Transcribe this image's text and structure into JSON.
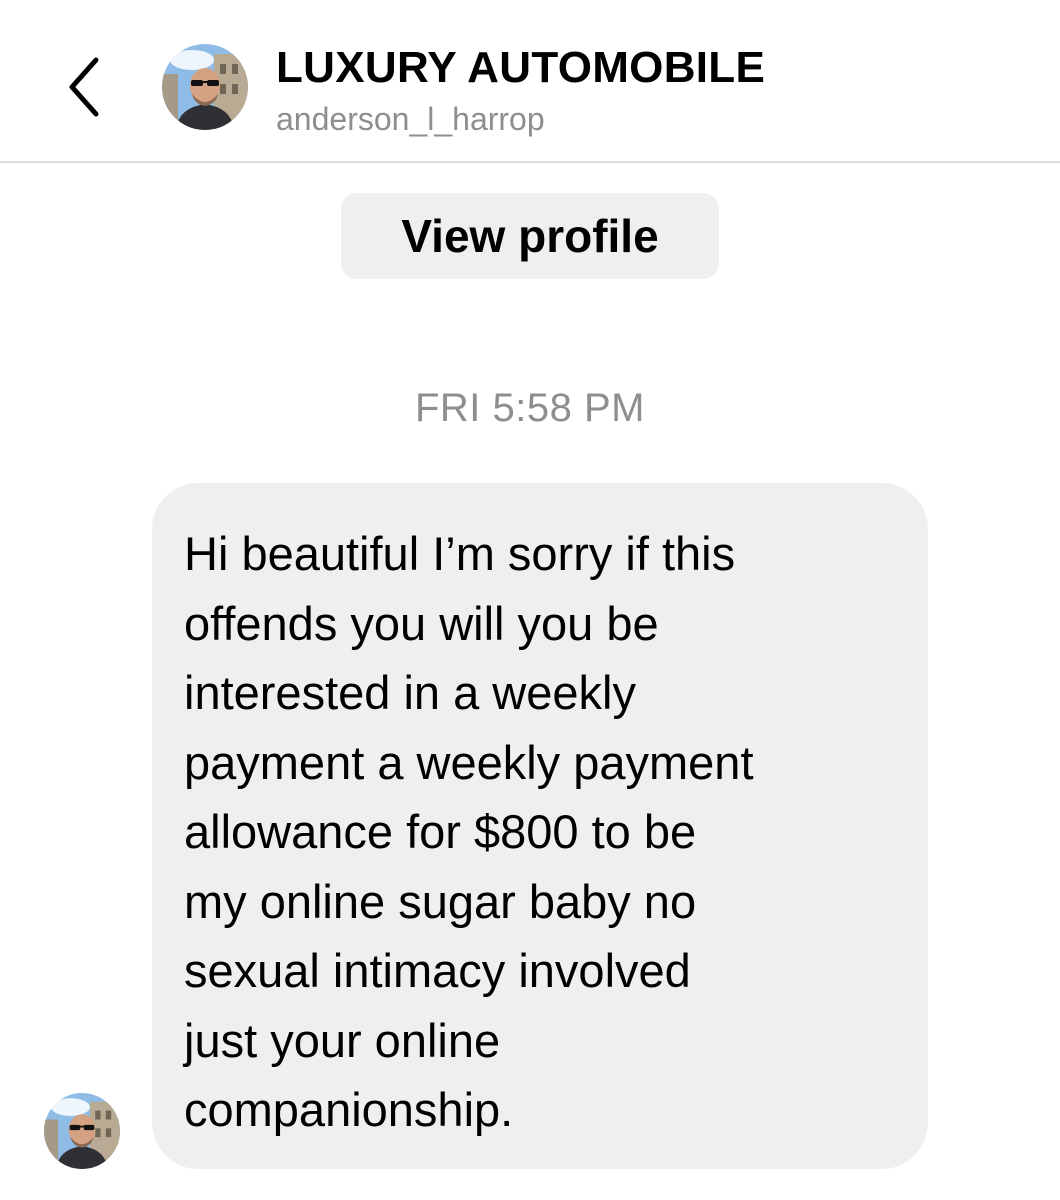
{
  "header": {
    "title": "LUXURY AUTOMOBILE",
    "username": "anderson_l_harrop",
    "back_icon": "chevron-left-icon"
  },
  "profile_button": {
    "label": "View profile"
  },
  "conversation": {
    "timestamp": "FRI 5:58 PM",
    "message": {
      "lines": [
        "Hi beautiful I’m sorry if this",
        "offends you will you be",
        "interested in a weekly",
        "payment a weekly payment",
        "allowance for $800 to be",
        "my online sugar baby no",
        "sexual intimacy involved",
        "just your online",
        "companionship."
      ]
    }
  },
  "colors": {
    "bubble_background": "#efefef",
    "secondary_text": "#8e8e8e",
    "divider": "#dbdbdb"
  }
}
